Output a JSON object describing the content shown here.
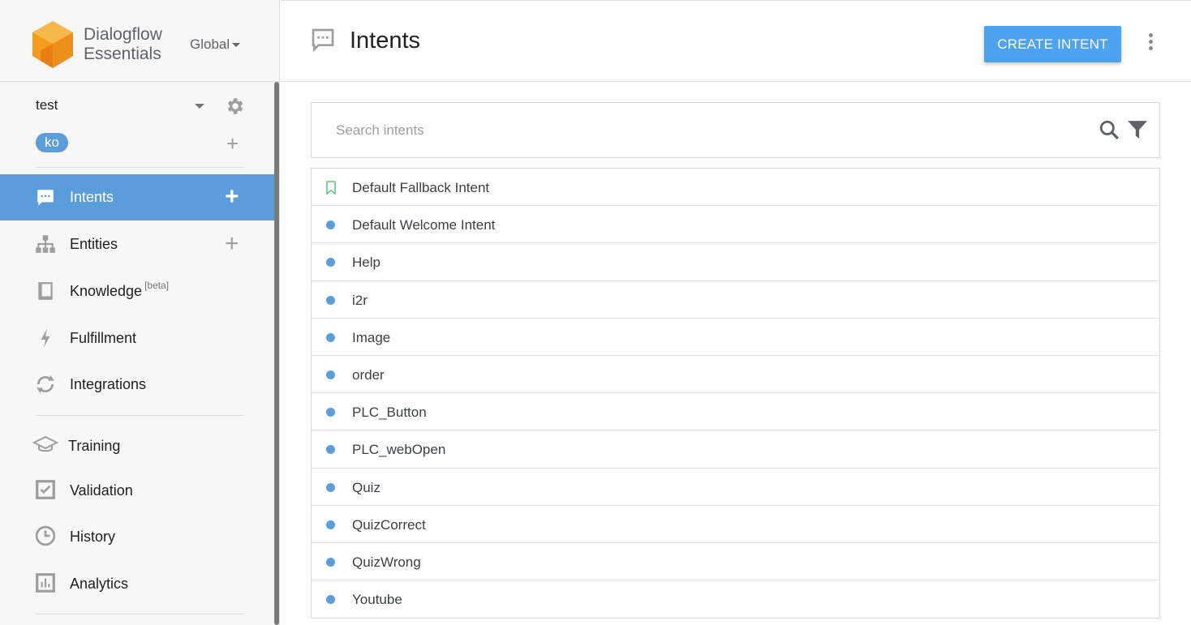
{
  "brand": {
    "line1": "Dialogflow",
    "line2": "Essentials",
    "region": "Global"
  },
  "agent": {
    "name": "test",
    "language": "ko"
  },
  "sidebar": {
    "items": [
      {
        "label": "Intents",
        "icon": "chat-icon",
        "active": true,
        "has_add": true
      },
      {
        "label": "Entities",
        "icon": "hierarchy-icon",
        "has_add": true
      },
      {
        "label": "Knowledge",
        "icon": "book-icon",
        "badge": "[beta]"
      },
      {
        "label": "Fulfillment",
        "icon": "bolt-icon"
      },
      {
        "label": "Integrations",
        "icon": "sync-icon"
      },
      {
        "label": "Training",
        "icon": "graduation-cap-icon"
      },
      {
        "label": "Validation",
        "icon": "check-box-icon"
      },
      {
        "label": "History",
        "icon": "clock-icon"
      },
      {
        "label": "Analytics",
        "icon": "bar-chart-icon"
      }
    ]
  },
  "header": {
    "title": "Intents",
    "create_label": "CREATE INTENT"
  },
  "search": {
    "placeholder": "Search intents"
  },
  "intents": [
    {
      "name": "Default Fallback Intent",
      "marker": "bookmark"
    },
    {
      "name": "Default Welcome Intent",
      "marker": "dot"
    },
    {
      "name": "Help",
      "marker": "dot"
    },
    {
      "name": "i2r",
      "marker": "dot"
    },
    {
      "name": "Image",
      "marker": "dot"
    },
    {
      "name": "order",
      "marker": "dot"
    },
    {
      "name": "PLC_Button",
      "marker": "dot"
    },
    {
      "name": "PLC_webOpen",
      "marker": "dot"
    },
    {
      "name": "Quiz",
      "marker": "dot"
    },
    {
      "name": "QuizCorrect",
      "marker": "dot"
    },
    {
      "name": "QuizWrong",
      "marker": "dot"
    },
    {
      "name": "Youtube",
      "marker": "dot"
    }
  ],
  "colors": {
    "accent": "#5b9ddb",
    "button": "#4da3f0",
    "logo_orange": "#f5a623",
    "bookmark_green": "#6cc18a"
  }
}
